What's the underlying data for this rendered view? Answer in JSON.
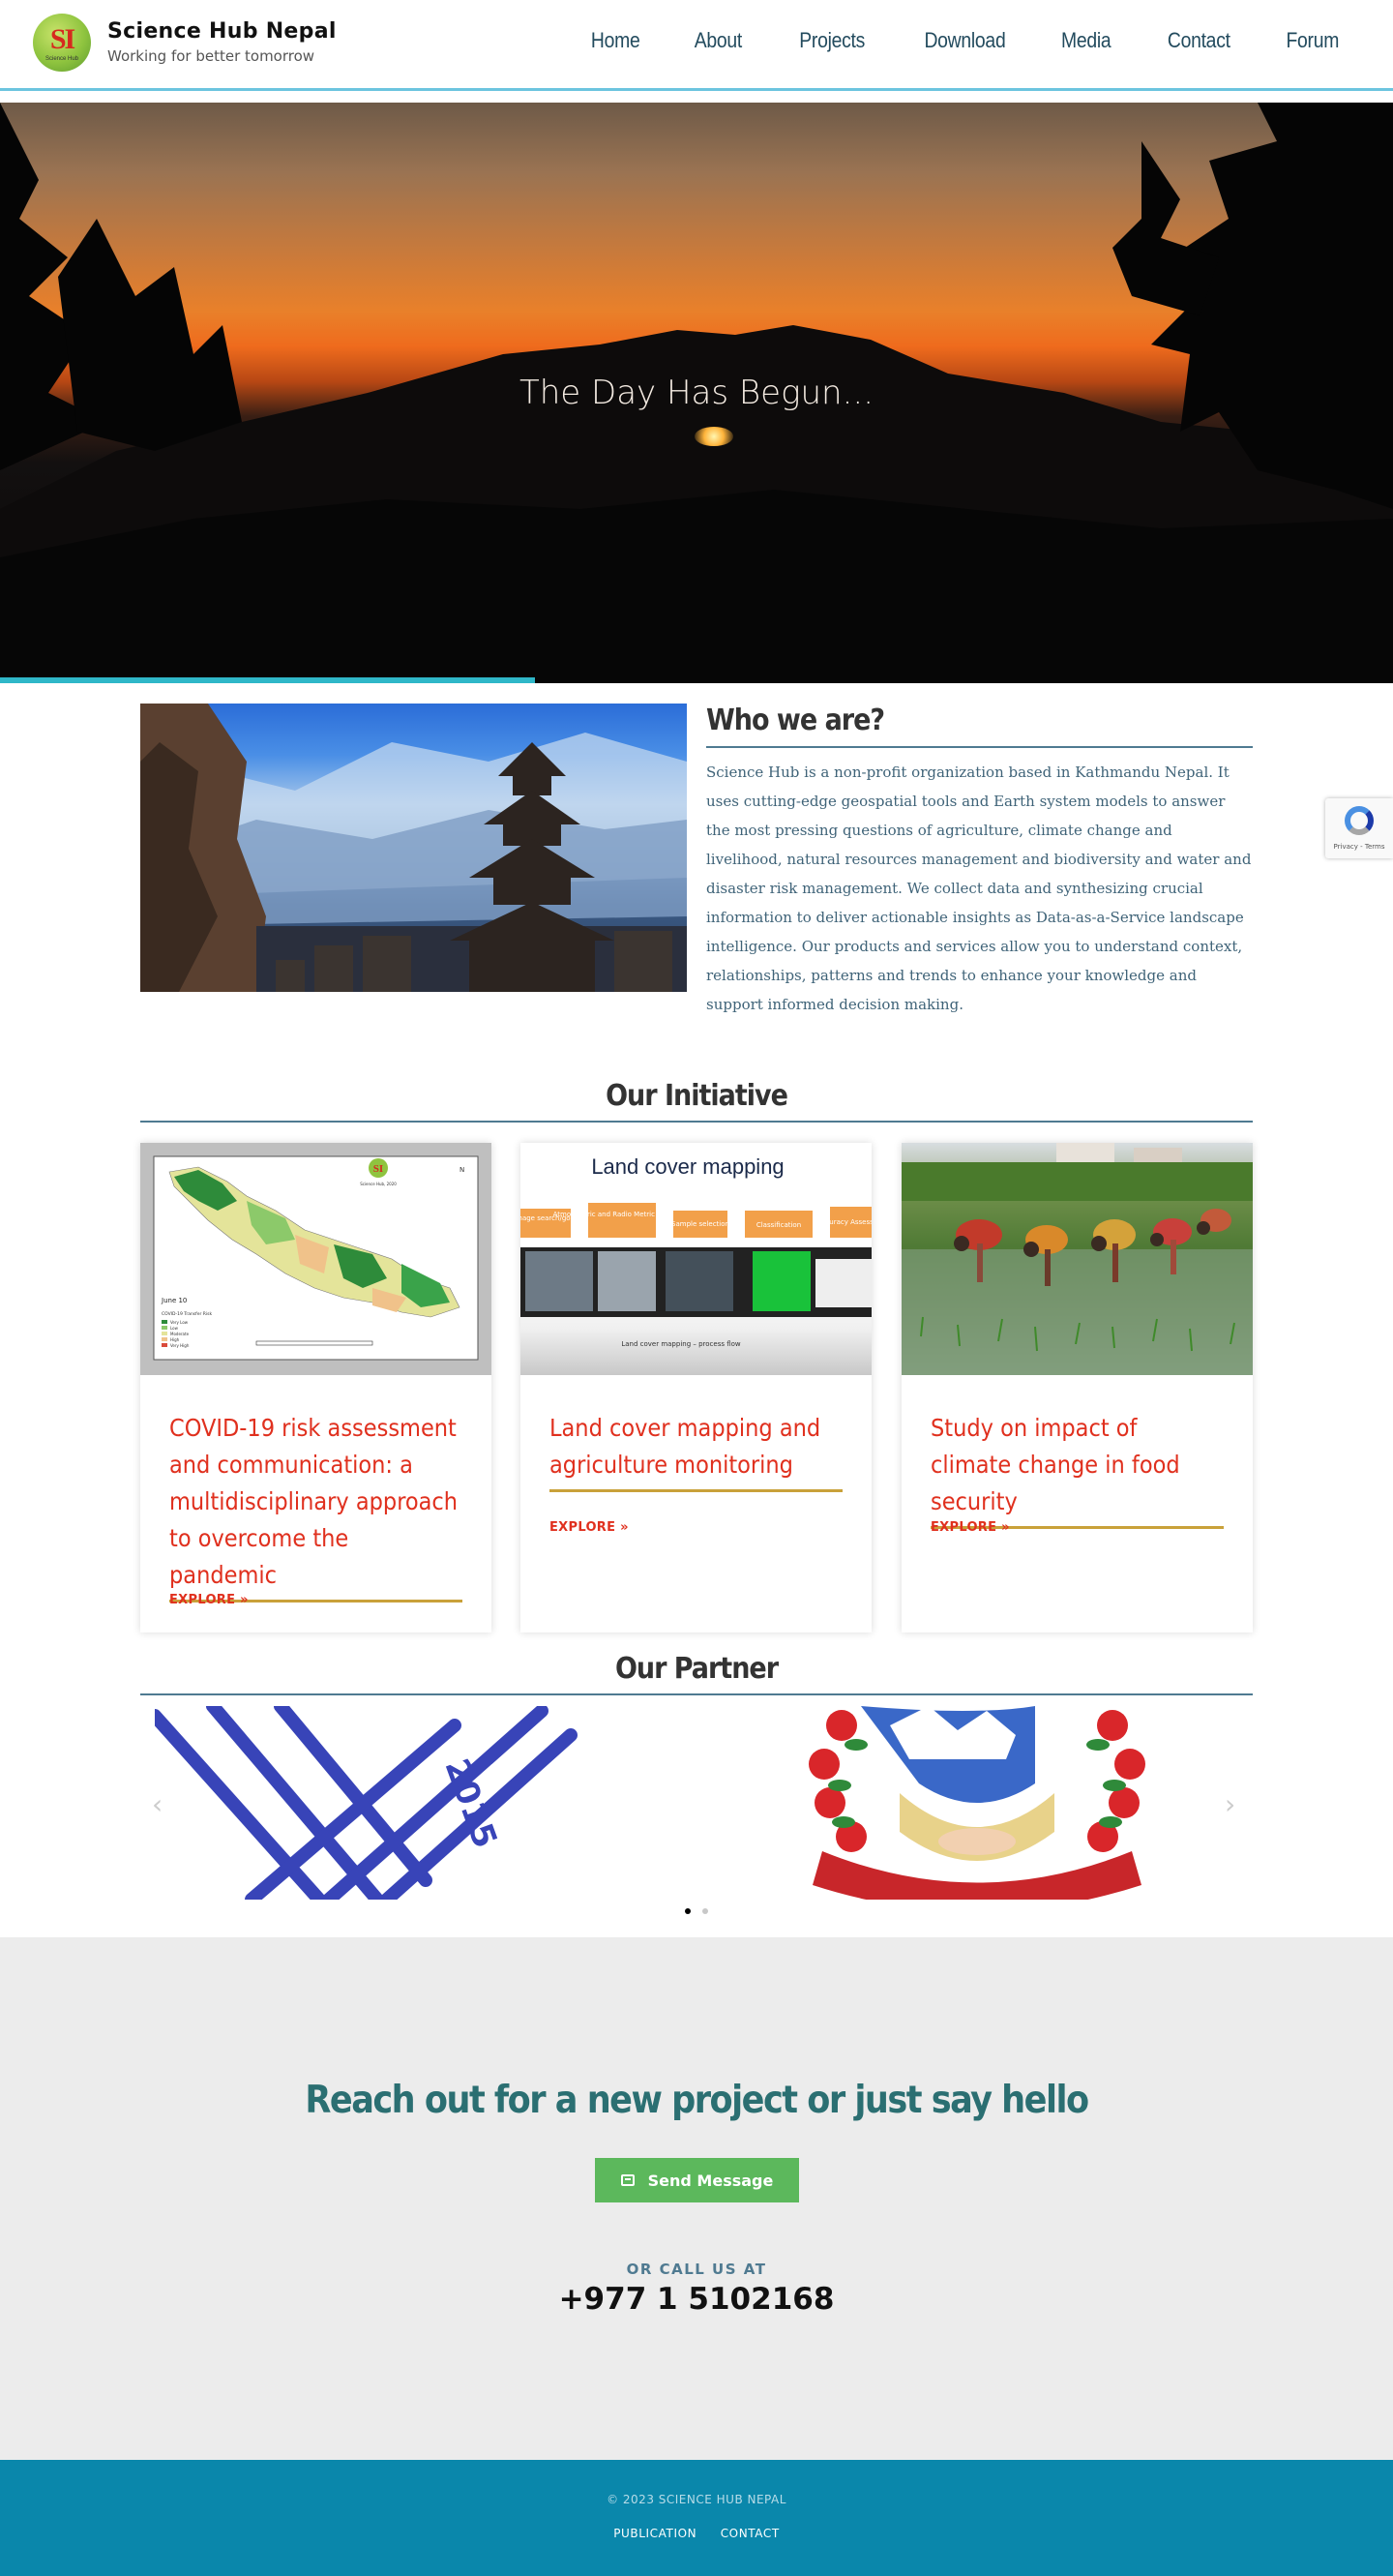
{
  "header": {
    "logo_text": "SI",
    "logo_subtext": "Science Hub",
    "brand_name": "Science Hub Nepal",
    "tagline": "Working for better tomorrow",
    "nav": [
      "Home",
      "About",
      "Projects",
      "Download",
      "Media",
      "Contact",
      "Forum"
    ]
  },
  "hero": {
    "title": "The Day Has Begun..."
  },
  "about": {
    "title": "Who we are?",
    "text": "Science Hub is a non-profit organization based in Kathmandu Nepal. It uses cutting-edge geospatial tools and Earth system models to answer the most pressing questions of agriculture, climate change and livelihood, natural resources management and biodiversity and water and disaster risk management. We collect data and synthesizing crucial information to deliver actionable insights as Data-as-a-Service landscape intelligence. Our products and services allow you to understand context, relationships, patterns and trends to enhance your knowledge and support informed decision making."
  },
  "initiative": {
    "title": "Our Initiative",
    "cards": [
      {
        "title": "COVID-19 risk assessment and communication: a multidisciplinary approach to overcome the pandemic",
        "explore": "EXPLORE »",
        "image": {
          "date": "June 10",
          "legend_title": "COVID-19 Transfer Risk",
          "legend": [
            "Very Low",
            "Low",
            "Moderate",
            "High",
            "Very High"
          ],
          "logo": "SI",
          "logo_caption": "Science Hub, 2020",
          "north": "N"
        }
      },
      {
        "title": "Land cover mapping and agriculture monitoring",
        "explore": "EXPLORE »",
        "image": {
          "heading": "Land cover mapping",
          "steps": [
            "EO selection, Image search/go and download",
            "Atmospheric and Radio Metric correction",
            "Sample selection",
            "Classification",
            "Accuracy Assessment"
          ],
          "caption": "Land cover mapping – process flow"
        }
      },
      {
        "title": "Study on impact of climate change in food security",
        "explore": "EXPLORE »"
      }
    ]
  },
  "partner": {
    "title": "Our Partner",
    "stamp_text": "2015",
    "prev": "‹",
    "next": "›"
  },
  "contact": {
    "title": "Reach out for a new project or just say hello",
    "button": "Send Message",
    "call_label": "OR CALL US AT",
    "phone": "+977 1 5102168"
  },
  "footer": {
    "copyright": "© 2023 SCIENCE HUB NEPAL",
    "links": [
      "PUBLICATION",
      "CONTACT"
    ]
  },
  "recaptcha": {
    "text": "Privacy - Terms"
  },
  "colors": {
    "nav": "#234b5e",
    "accent_red": "#e0301e",
    "heading_teal": "#2b6f72",
    "button_green": "#5cb85c",
    "footer_blue": "#0a87ab"
  }
}
